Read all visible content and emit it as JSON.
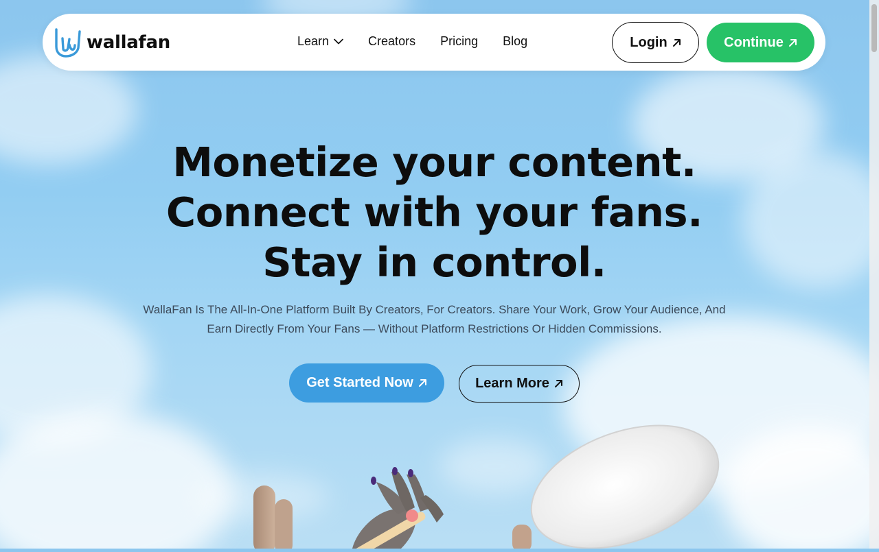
{
  "brand": {
    "name": "wallafan"
  },
  "nav": {
    "items": [
      {
        "label": "Learn",
        "has_dropdown": true
      },
      {
        "label": "Creators"
      },
      {
        "label": "Pricing"
      },
      {
        "label": "Blog"
      }
    ],
    "login_label": "Login",
    "continue_label": "Continue"
  },
  "hero": {
    "headline_lines": [
      "Monetize your content.",
      "Connect with your fans.",
      "Stay in control."
    ],
    "subtitle": "WallaFan Is The All-In-One Platform Built By Creators, For Creators. Share Your Work, Grow Your Audience, And Earn Directly From Your Fans — Without Platform Restrictions Or Hidden Commissions.",
    "primary_cta": "Get Started Now",
    "secondary_cta": "Learn More"
  },
  "icons": {
    "logo": "rock-hand-icon",
    "dropdown": "chevron-down-icon",
    "external": "arrow-up-right-icon"
  },
  "colors": {
    "brand_blue": "#3d9de0",
    "continue_green": "#27c267",
    "text_dark": "#0d0d0d",
    "sky_blue": "#8cc6ee"
  }
}
